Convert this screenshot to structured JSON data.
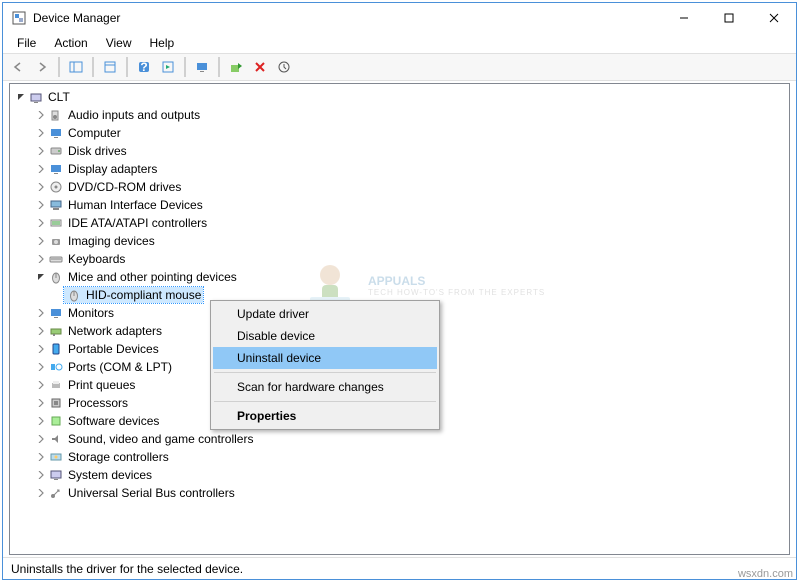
{
  "window": {
    "title": "Device Manager"
  },
  "menu": {
    "file": "File",
    "action": "Action",
    "view": "View",
    "help": "Help"
  },
  "tree": {
    "root": "CLT",
    "cats": [
      "Audio inputs and outputs",
      "Computer",
      "Disk drives",
      "Display adapters",
      "DVD/CD-ROM drives",
      "Human Interface Devices",
      "IDE ATA/ATAPI controllers",
      "Imaging devices",
      "Keyboards",
      "Mice and other pointing devices",
      "Monitors",
      "Network adapters",
      "Portable Devices",
      "Ports (COM & LPT)",
      "Print queues",
      "Processors",
      "Software devices",
      "Sound, video and game controllers",
      "Storage controllers",
      "System devices",
      "Universal Serial Bus controllers"
    ],
    "selected_child": "HID-compliant mouse"
  },
  "ctx": {
    "update": "Update driver",
    "disable": "Disable device",
    "uninstall": "Uninstall device",
    "scan": "Scan for hardware changes",
    "props": "Properties"
  },
  "status": "Uninstalls the driver for the selected device.",
  "watermark": {
    "brand": "APPUALS",
    "tag": "TECH HOW-TO'S FROM THE EXPERTS",
    "url": "wsxdn.com"
  }
}
